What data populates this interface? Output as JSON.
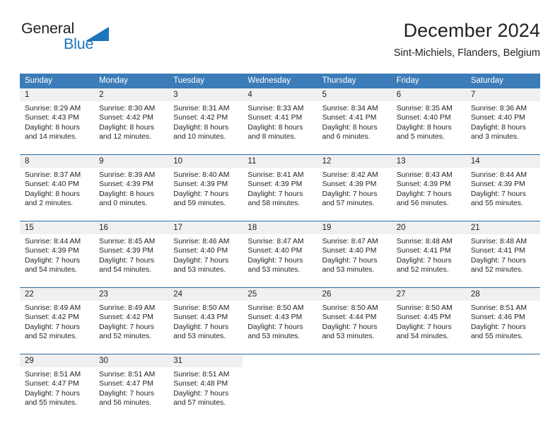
{
  "brand": {
    "name_part1": "General",
    "name_part2": "Blue",
    "accent_color": "#1b75bb"
  },
  "header": {
    "title": "December 2024",
    "subtitle": "Sint-Michiels, Flanders, Belgium"
  },
  "theme": {
    "header_row_bg": "#3c7cb8",
    "day_number_bg": "#f0f0f0",
    "row_divider": "#2e6da4",
    "text_color": "#231f20"
  },
  "weekdays": [
    "Sunday",
    "Monday",
    "Tuesday",
    "Wednesday",
    "Thursday",
    "Friday",
    "Saturday"
  ],
  "weeks": [
    [
      {
        "day": "1",
        "sunrise": "Sunrise: 8:29 AM",
        "sunset": "Sunset: 4:43 PM",
        "daylight_line1": "Daylight: 8 hours",
        "daylight_line2": "and 14 minutes."
      },
      {
        "day": "2",
        "sunrise": "Sunrise: 8:30 AM",
        "sunset": "Sunset: 4:42 PM",
        "daylight_line1": "Daylight: 8 hours",
        "daylight_line2": "and 12 minutes."
      },
      {
        "day": "3",
        "sunrise": "Sunrise: 8:31 AM",
        "sunset": "Sunset: 4:42 PM",
        "daylight_line1": "Daylight: 8 hours",
        "daylight_line2": "and 10 minutes."
      },
      {
        "day": "4",
        "sunrise": "Sunrise: 8:33 AM",
        "sunset": "Sunset: 4:41 PM",
        "daylight_line1": "Daylight: 8 hours",
        "daylight_line2": "and 8 minutes."
      },
      {
        "day": "5",
        "sunrise": "Sunrise: 8:34 AM",
        "sunset": "Sunset: 4:41 PM",
        "daylight_line1": "Daylight: 8 hours",
        "daylight_line2": "and 6 minutes."
      },
      {
        "day": "6",
        "sunrise": "Sunrise: 8:35 AM",
        "sunset": "Sunset: 4:40 PM",
        "daylight_line1": "Daylight: 8 hours",
        "daylight_line2": "and 5 minutes."
      },
      {
        "day": "7",
        "sunrise": "Sunrise: 8:36 AM",
        "sunset": "Sunset: 4:40 PM",
        "daylight_line1": "Daylight: 8 hours",
        "daylight_line2": "and 3 minutes."
      }
    ],
    [
      {
        "day": "8",
        "sunrise": "Sunrise: 8:37 AM",
        "sunset": "Sunset: 4:40 PM",
        "daylight_line1": "Daylight: 8 hours",
        "daylight_line2": "and 2 minutes."
      },
      {
        "day": "9",
        "sunrise": "Sunrise: 8:39 AM",
        "sunset": "Sunset: 4:39 PM",
        "daylight_line1": "Daylight: 8 hours",
        "daylight_line2": "and 0 minutes."
      },
      {
        "day": "10",
        "sunrise": "Sunrise: 8:40 AM",
        "sunset": "Sunset: 4:39 PM",
        "daylight_line1": "Daylight: 7 hours",
        "daylight_line2": "and 59 minutes."
      },
      {
        "day": "11",
        "sunrise": "Sunrise: 8:41 AM",
        "sunset": "Sunset: 4:39 PM",
        "daylight_line1": "Daylight: 7 hours",
        "daylight_line2": "and 58 minutes."
      },
      {
        "day": "12",
        "sunrise": "Sunrise: 8:42 AM",
        "sunset": "Sunset: 4:39 PM",
        "daylight_line1": "Daylight: 7 hours",
        "daylight_line2": "and 57 minutes."
      },
      {
        "day": "13",
        "sunrise": "Sunrise: 8:43 AM",
        "sunset": "Sunset: 4:39 PM",
        "daylight_line1": "Daylight: 7 hours",
        "daylight_line2": "and 56 minutes."
      },
      {
        "day": "14",
        "sunrise": "Sunrise: 8:44 AM",
        "sunset": "Sunset: 4:39 PM",
        "daylight_line1": "Daylight: 7 hours",
        "daylight_line2": "and 55 minutes."
      }
    ],
    [
      {
        "day": "15",
        "sunrise": "Sunrise: 8:44 AM",
        "sunset": "Sunset: 4:39 PM",
        "daylight_line1": "Daylight: 7 hours",
        "daylight_line2": "and 54 minutes."
      },
      {
        "day": "16",
        "sunrise": "Sunrise: 8:45 AM",
        "sunset": "Sunset: 4:39 PM",
        "daylight_line1": "Daylight: 7 hours",
        "daylight_line2": "and 54 minutes."
      },
      {
        "day": "17",
        "sunrise": "Sunrise: 8:46 AM",
        "sunset": "Sunset: 4:40 PM",
        "daylight_line1": "Daylight: 7 hours",
        "daylight_line2": "and 53 minutes."
      },
      {
        "day": "18",
        "sunrise": "Sunrise: 8:47 AM",
        "sunset": "Sunset: 4:40 PM",
        "daylight_line1": "Daylight: 7 hours",
        "daylight_line2": "and 53 minutes."
      },
      {
        "day": "19",
        "sunrise": "Sunrise: 8:47 AM",
        "sunset": "Sunset: 4:40 PM",
        "daylight_line1": "Daylight: 7 hours",
        "daylight_line2": "and 53 minutes."
      },
      {
        "day": "20",
        "sunrise": "Sunrise: 8:48 AM",
        "sunset": "Sunset: 4:41 PM",
        "daylight_line1": "Daylight: 7 hours",
        "daylight_line2": "and 52 minutes."
      },
      {
        "day": "21",
        "sunrise": "Sunrise: 8:48 AM",
        "sunset": "Sunset: 4:41 PM",
        "daylight_line1": "Daylight: 7 hours",
        "daylight_line2": "and 52 minutes."
      }
    ],
    [
      {
        "day": "22",
        "sunrise": "Sunrise: 8:49 AM",
        "sunset": "Sunset: 4:42 PM",
        "daylight_line1": "Daylight: 7 hours",
        "daylight_line2": "and 52 minutes."
      },
      {
        "day": "23",
        "sunrise": "Sunrise: 8:49 AM",
        "sunset": "Sunset: 4:42 PM",
        "daylight_line1": "Daylight: 7 hours",
        "daylight_line2": "and 52 minutes."
      },
      {
        "day": "24",
        "sunrise": "Sunrise: 8:50 AM",
        "sunset": "Sunset: 4:43 PM",
        "daylight_line1": "Daylight: 7 hours",
        "daylight_line2": "and 53 minutes."
      },
      {
        "day": "25",
        "sunrise": "Sunrise: 8:50 AM",
        "sunset": "Sunset: 4:43 PM",
        "daylight_line1": "Daylight: 7 hours",
        "daylight_line2": "and 53 minutes."
      },
      {
        "day": "26",
        "sunrise": "Sunrise: 8:50 AM",
        "sunset": "Sunset: 4:44 PM",
        "daylight_line1": "Daylight: 7 hours",
        "daylight_line2": "and 53 minutes."
      },
      {
        "day": "27",
        "sunrise": "Sunrise: 8:50 AM",
        "sunset": "Sunset: 4:45 PM",
        "daylight_line1": "Daylight: 7 hours",
        "daylight_line2": "and 54 minutes."
      },
      {
        "day": "28",
        "sunrise": "Sunrise: 8:51 AM",
        "sunset": "Sunset: 4:46 PM",
        "daylight_line1": "Daylight: 7 hours",
        "daylight_line2": "and 55 minutes."
      }
    ],
    [
      {
        "day": "29",
        "sunrise": "Sunrise: 8:51 AM",
        "sunset": "Sunset: 4:47 PM",
        "daylight_line1": "Daylight: 7 hours",
        "daylight_line2": "and 55 minutes."
      },
      {
        "day": "30",
        "sunrise": "Sunrise: 8:51 AM",
        "sunset": "Sunset: 4:47 PM",
        "daylight_line1": "Daylight: 7 hours",
        "daylight_line2": "and 56 minutes."
      },
      {
        "day": "31",
        "sunrise": "Sunrise: 8:51 AM",
        "sunset": "Sunset: 4:48 PM",
        "daylight_line1": "Daylight: 7 hours",
        "daylight_line2": "and 57 minutes."
      },
      {
        "day": "",
        "sunrise": "",
        "sunset": "",
        "daylight_line1": "",
        "daylight_line2": ""
      },
      {
        "day": "",
        "sunrise": "",
        "sunset": "",
        "daylight_line1": "",
        "daylight_line2": ""
      },
      {
        "day": "",
        "sunrise": "",
        "sunset": "",
        "daylight_line1": "",
        "daylight_line2": ""
      },
      {
        "day": "",
        "sunrise": "",
        "sunset": "",
        "daylight_line1": "",
        "daylight_line2": ""
      }
    ]
  ]
}
